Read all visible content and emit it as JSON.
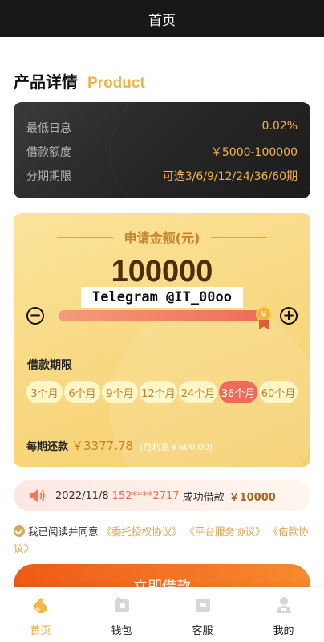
{
  "topbar": {
    "title": "首页"
  },
  "section": {
    "title": "产品详情",
    "subtitle": "Product"
  },
  "info": {
    "rows": [
      {
        "label": "最低日息",
        "value": "0.02%"
      },
      {
        "label": "借款额度",
        "value": "￥5000-100000"
      },
      {
        "label": "分期期限",
        "value": "可选3/6/9/12/24/36/60期"
      }
    ]
  },
  "loan": {
    "apply_title": "申请金额(元)",
    "amount": "100000",
    "watermark": "Telegram @IT_00oo",
    "slider_fraction": 1.0,
    "handle_symbol": "¥",
    "minus": "−",
    "plus": "+",
    "term_label": "借款期限",
    "terms": [
      "3个月",
      "6个月",
      "9个月",
      "12个月",
      "24个月",
      "36个月",
      "60个月"
    ],
    "active_term_index": 5,
    "repay_label": "每期还款",
    "repay_value": "￥3377.78",
    "repay_interest": "(月利息￥600.00)"
  },
  "notice": {
    "date": "2022/11/8",
    "phone": "152****2717",
    "action": "成功借款",
    "amount": "￥10000"
  },
  "agree": {
    "prefix": "我已阅读并同意",
    "links": [
      "《委托授权协议》",
      "《平台服务协议》",
      "《借款协议》"
    ]
  },
  "apply_button": "立即借款",
  "tabs": [
    {
      "label": "首页",
      "icon": "home-icon",
      "active": true
    },
    {
      "label": "钱包",
      "icon": "wallet-icon",
      "active": false
    },
    {
      "label": "客服",
      "icon": "service-icon",
      "active": false
    },
    {
      "label": "我的",
      "icon": "profile-icon",
      "active": false
    }
  ],
  "colors": {
    "accent": "#f0b24a",
    "active_term": "#ef6a5a",
    "button": "#f05a18",
    "tab_active": "#e8a73b"
  }
}
